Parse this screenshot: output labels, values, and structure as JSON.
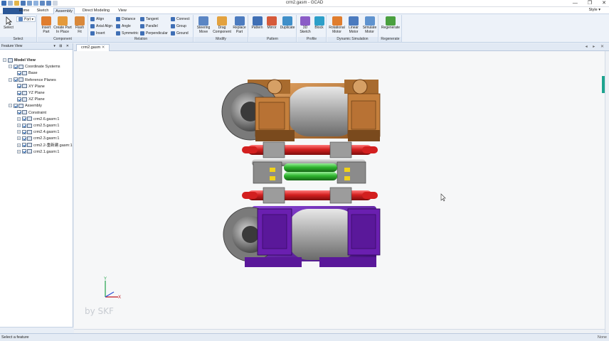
{
  "window": {
    "title": "crm2.gasm - GCAD",
    "controls": [
      "—",
      "❐",
      "✕"
    ]
  },
  "menu": {
    "tabs": [
      "Home",
      "Sketch",
      "Assembly",
      "Direct Modeling",
      "View"
    ],
    "active_tab": "Assembly",
    "style_label": "Style ▾"
  },
  "ribbon": {
    "select": {
      "big": "Select",
      "part_dropdown": "Part",
      "group": "Select"
    },
    "component": {
      "buttons": [
        "Insert\nPart",
        "Create Part\nIn Place",
        "Flash\nFit"
      ],
      "group": "Component"
    },
    "relation": {
      "col1": [
        "Align",
        "Axial Align",
        "Insert"
      ],
      "col2": [
        "Distance",
        "Angle",
        "Symmetric"
      ],
      "col3": [
        "Tangent",
        "Parallel",
        "Perpendicular"
      ],
      "col4": [
        "Connect",
        "Group",
        "Ground"
      ],
      "group": "Relation"
    },
    "modify": {
      "buttons": [
        "Steering\nMove",
        "Drag\nComponent",
        "Replace\nPart"
      ],
      "group": "Modify"
    },
    "pattern": {
      "buttons": [
        "Pattern",
        "Mirror",
        "Duplicate"
      ],
      "group": "Pattern"
    },
    "profile": {
      "buttons": [
        "3D\nSketch",
        "Block"
      ],
      "group": "Profile"
    },
    "simulation": {
      "buttons": [
        "Rotational\nMotor",
        "Linear\nMotor",
        "Simulate\nMotor"
      ],
      "group": "Dynamic Simulation"
    },
    "regenerate": {
      "buttons": [
        "Regenerate"
      ],
      "group": "Regenerate"
    }
  },
  "feature_view": {
    "title": "Feature View",
    "header_buttons": "▾ ⊞ ✕",
    "tree": [
      {
        "label": "Model View",
        "level": 0,
        "bold": true
      },
      {
        "label": "Coordinate Systems",
        "level": 1
      },
      {
        "label": "Base",
        "level": 2
      },
      {
        "label": "Reference Planes",
        "level": 1
      },
      {
        "label": "XY Plane",
        "level": 2
      },
      {
        "label": "YZ Plane",
        "level": 2
      },
      {
        "label": "XZ Plane",
        "level": 2
      },
      {
        "label": "Assembly",
        "level": 1
      },
      {
        "label": "Constraint",
        "level": 2
      },
      {
        "label": "crm2.6.gasm:1",
        "level": 2
      },
      {
        "label": "crm2.5.gasm:1",
        "level": 2
      },
      {
        "label": "crm2.4.gasm:1",
        "level": 2
      },
      {
        "label": "crm2.3.gasm:1",
        "level": 2
      },
      {
        "label": "crm2.2-重新建.gasm:1",
        "level": 2
      },
      {
        "label": "crm2.1.gasm:1",
        "level": 2
      }
    ]
  },
  "document": {
    "tab": "crm2.gasm",
    "nav": "◂ ▸ ✕",
    "watermark": "by SKF",
    "axis_y": "Y",
    "axis_x": "X"
  },
  "status": {
    "text": "Select a feature",
    "right": "None"
  },
  "colors": {
    "accent": "#1a5fb4",
    "motor_orange": "#c7803b",
    "motor_purple": "#6a1fb0",
    "roller_red": "#d31f1f",
    "roller_green": "#2fb52f"
  }
}
